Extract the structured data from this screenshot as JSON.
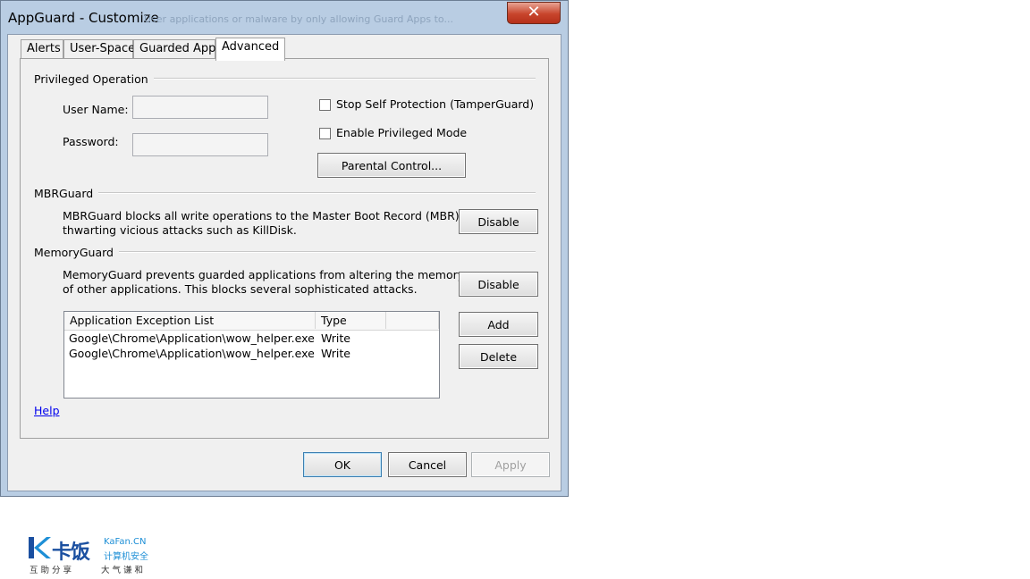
{
  "window": {
    "title": "AppGuard - Customize",
    "ghost_title": "User applications or malware by only allowing Guard Apps to..."
  },
  "tabs": [
    {
      "label": "Alerts",
      "active": false
    },
    {
      "label": "User-Space",
      "active": false
    },
    {
      "label": "Guarded Apps",
      "active": false
    },
    {
      "label": "Advanced",
      "active": true
    }
  ],
  "privileged": {
    "group_label": "Privileged Operation",
    "username_label": "User Name:",
    "username_value": "",
    "password_label": "Password:",
    "password_value": "",
    "stop_self_protection_label": "Stop Self Protection (TamperGuard)",
    "stop_self_protection_checked": false,
    "enable_privileged_label": "Enable Privileged Mode",
    "enable_privileged_checked": false,
    "parental_control_label": "Parental Control..."
  },
  "mbrguard": {
    "group_label": "MBRGuard",
    "desc_line1": "MBRGuard blocks all write operations to the Master Boot Record (MBR),",
    "desc_line2": "thwarting vicious attacks such as KillDisk.",
    "button_label": "Disable"
  },
  "memoryguard": {
    "group_label": "MemoryGuard",
    "desc_line1": "MemoryGuard prevents guarded applications from altering the memory",
    "desc_line2": "of other applications. This blocks several sophisticated attacks.",
    "button_label": "Disable",
    "add_label": "Add",
    "delete_label": "Delete",
    "list": {
      "columns": [
        "Application Exception List",
        "Type",
        ""
      ],
      "rows": [
        {
          "app": "Google\\Chrome\\Application\\wow_helper.exe",
          "type": "Write"
        },
        {
          "app": "Google\\Chrome\\Application\\wow_helper.exe",
          "type": "Write"
        }
      ]
    }
  },
  "help_label": "Help",
  "footer": {
    "ok_label": "OK",
    "cancel_label": "Cancel",
    "apply_label": "Apply"
  },
  "watermark": {
    "brand_cn": "卡饭",
    "brand_en": "KaFan.CN",
    "sub_cn": "计算机安全",
    "slogan_left": "互助分享",
    "slogan_right": "大气谦和",
    "brand_color": "#1a4fa0"
  }
}
